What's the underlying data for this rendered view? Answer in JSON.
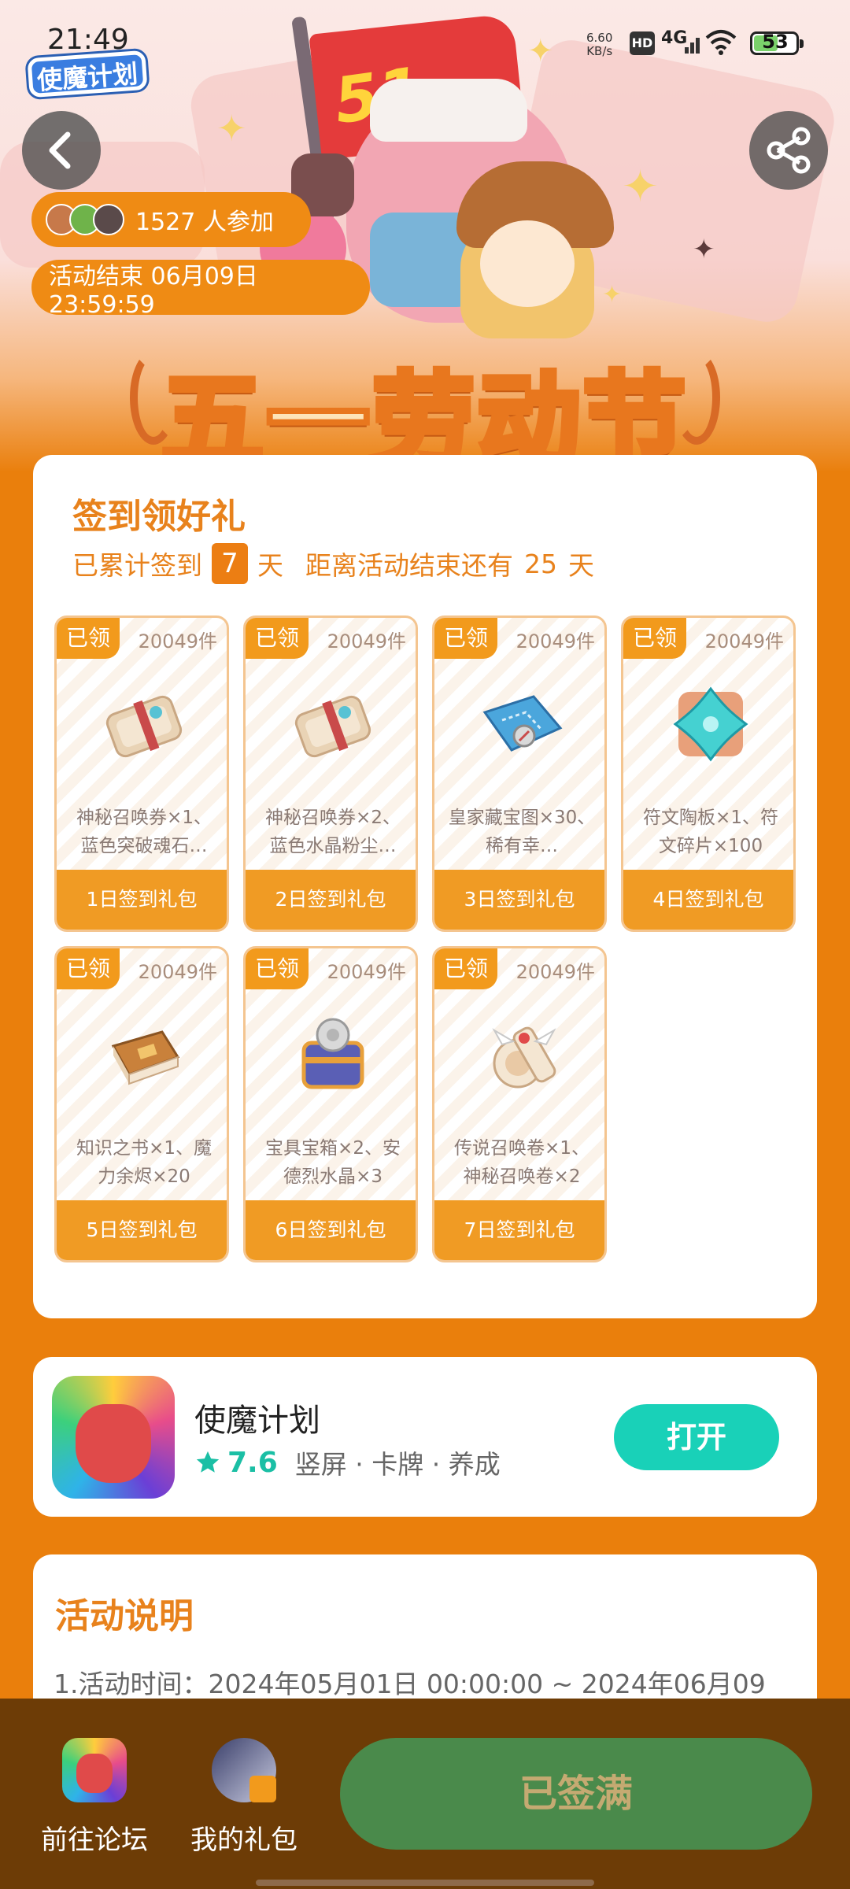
{
  "status_bar": {
    "time": "21:49",
    "net_speed_value": "6.60",
    "net_speed_unit": "KB/s",
    "hd_label": "HD",
    "network": "4G",
    "battery": "53"
  },
  "header": {
    "game_logo_text": "使魔计划",
    "banner_title": "五一劳动节",
    "flag_text": "51",
    "participants": "1527 人参加",
    "end_time": "活动结束 06月09日 23:59:59"
  },
  "checkin": {
    "title": "签到领好礼",
    "progress_prefix": "已累计签到",
    "days_signed": "7",
    "days_unit": "天",
    "remaining_prefix": "距离活动结束还有",
    "remaining_days": "25",
    "remaining_unit": "天",
    "gifts": [
      {
        "tag": "已领",
        "count": "20049件",
        "desc": "神秘召唤券×1、蓝色突破魂石…",
        "label": "1日签到礼包",
        "icon": "scroll-icon"
      },
      {
        "tag": "已领",
        "count": "20049件",
        "desc": "神秘召唤券×2、蓝色水晶粉尘…",
        "label": "2日签到礼包",
        "icon": "scroll-icon"
      },
      {
        "tag": "已领",
        "count": "20049件",
        "desc": "皇家藏宝图×30、稀有幸…",
        "label": "3日签到礼包",
        "icon": "treasure-map-icon"
      },
      {
        "tag": "已领",
        "count": "20049件",
        "desc": "符文陶板×1、符文碎片×100",
        "label": "4日签到礼包",
        "icon": "rune-tablet-icon"
      },
      {
        "tag": "已领",
        "count": "20049件",
        "desc": "知识之书×1、魔力余烬×20",
        "label": "5日签到礼包",
        "icon": "book-icon"
      },
      {
        "tag": "已领",
        "count": "20049件",
        "desc": "宝具宝箱×2、安德烈水晶×3",
        "label": "6日签到礼包",
        "icon": "treasure-chest-icon"
      },
      {
        "tag": "已领",
        "count": "20049件",
        "desc": "传说召唤卷×1、神秘召唤卷×2",
        "label": "7日签到礼包",
        "icon": "legend-scroll-icon"
      }
    ]
  },
  "app": {
    "name": "使魔计划",
    "rating": "7.6",
    "tags": "竖屏 · 卡牌 · 养成",
    "open_label": "打开"
  },
  "rules": {
    "title": "活动说明",
    "line1": "1.活动时间：2024年05月01日 00:00:00 ~ 2024年06月09"
  },
  "bottom": {
    "forum_label": "前往论坛",
    "gifts_label": "我的礼包",
    "signed_label": "已签满"
  },
  "colors": {
    "page_bg": "#ea7f0c",
    "accent_orange": "#f09b24",
    "title_orange": "#e8821c",
    "open_button": "#19d1b8",
    "signed_button": "#4a8a4b",
    "bottom_bar": "#6d3c06"
  }
}
